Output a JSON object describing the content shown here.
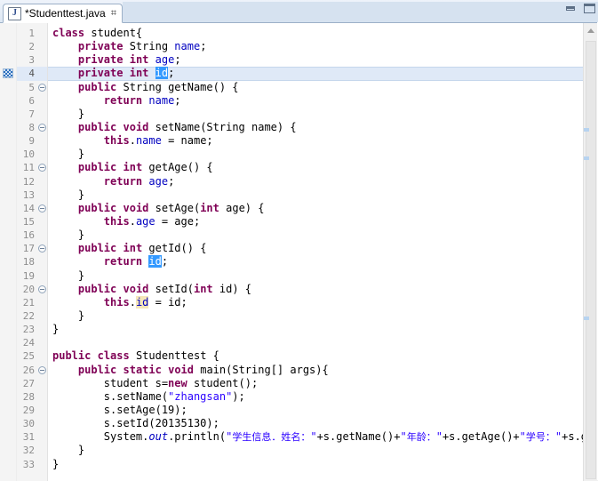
{
  "window": {
    "minimize_label": "Minimize",
    "maximize_label": "Maximize",
    "minimize_icon": "minimize-icon",
    "maximize_icon": "maximize-icon"
  },
  "tab": {
    "icon_glyph": "J",
    "icon_name": "java-file-icon",
    "title": "*Studenttest.java",
    "close_glyph": "⌗",
    "dirty": true
  },
  "editor": {
    "current_line": 4,
    "marker_line": 4,
    "marker_name": "occurrence-marker",
    "line_count": 33,
    "selection_text": "id",
    "lines": [
      {
        "n": 1,
        "fold": false,
        "code_html": "<span class=\"kw\">class</span> student{"
      },
      {
        "n": 2,
        "fold": false,
        "code_html": "    <span class=\"kw\">private</span> String <span class=\"fld\">name</span>;"
      },
      {
        "n": 3,
        "fold": false,
        "code_html": "    <span class=\"kw\">private</span> <span class=\"kw\">int</span> <span class=\"fld\">age</span>;"
      },
      {
        "n": 4,
        "fold": false,
        "current": true,
        "code_html": "    <span class=\"kw\">private</span> <span class=\"kw\">int</span> <span class=\"sel\">id</span>;"
      },
      {
        "n": 5,
        "fold": true,
        "code_html": "    <span class=\"kw\">public</span> String getName() {"
      },
      {
        "n": 6,
        "fold": false,
        "code_html": "        <span class=\"kw\">return</span> <span class=\"fld\">name</span>;"
      },
      {
        "n": 7,
        "fold": false,
        "code_html": "    }"
      },
      {
        "n": 8,
        "fold": true,
        "code_html": "    <span class=\"kw\">public</span> <span class=\"kw\">void</span> setName(String name) {"
      },
      {
        "n": 9,
        "fold": false,
        "code_html": "        <span class=\"kw\">this</span>.<span class=\"fld\">name</span> = name;"
      },
      {
        "n": 10,
        "fold": false,
        "code_html": "    }"
      },
      {
        "n": 11,
        "fold": true,
        "code_html": "    <span class=\"kw\">public</span> <span class=\"kw\">int</span> getAge() {"
      },
      {
        "n": 12,
        "fold": false,
        "code_html": "        <span class=\"kw\">return</span> <span class=\"fld\">age</span>;"
      },
      {
        "n": 13,
        "fold": false,
        "code_html": "    }"
      },
      {
        "n": 14,
        "fold": true,
        "code_html": "    <span class=\"kw\">public</span> <span class=\"kw\">void</span> setAge(<span class=\"kw\">int</span> age) {"
      },
      {
        "n": 15,
        "fold": false,
        "code_html": "        <span class=\"kw\">this</span>.<span class=\"fld\">age</span> = age;"
      },
      {
        "n": 16,
        "fold": false,
        "code_html": "    }"
      },
      {
        "n": 17,
        "fold": true,
        "code_html": "    <span class=\"kw\">public</span> <span class=\"kw\">int</span> getId() {"
      },
      {
        "n": 18,
        "fold": false,
        "code_html": "        <span class=\"kw\">return</span> <span class=\"sel\">id</span>;"
      },
      {
        "n": 19,
        "fold": false,
        "code_html": "    }"
      },
      {
        "n": 20,
        "fold": true,
        "code_html": "    <span class=\"kw\">public</span> <span class=\"kw\">void</span> setId(<span class=\"kw\">int</span> id) {"
      },
      {
        "n": 21,
        "fold": false,
        "code_html": "        <span class=\"kw\">this</span>.<span class=\"fld occ\">id</span> = id;"
      },
      {
        "n": 22,
        "fold": false,
        "code_html": "    }"
      },
      {
        "n": 23,
        "fold": false,
        "code_html": "}"
      },
      {
        "n": 24,
        "fold": false,
        "code_html": ""
      },
      {
        "n": 25,
        "fold": false,
        "code_html": "<span class=\"kw\">public</span> <span class=\"kw\">class</span> Studenttest {"
      },
      {
        "n": 26,
        "fold": true,
        "code_html": "    <span class=\"kw\">public</span> <span class=\"kw\">static</span> <span class=\"kw\">void</span> main(String[] args){"
      },
      {
        "n": 27,
        "fold": false,
        "code_html": "        student s=<span class=\"kw\">new</span> student();"
      },
      {
        "n": 28,
        "fold": false,
        "code_html": "        s.setName(<span class=\"str\">\"zhangsan\"</span>);"
      },
      {
        "n": 29,
        "fold": false,
        "code_html": "        s.setAge(19);"
      },
      {
        "n": 30,
        "fold": false,
        "code_html": "        s.setId(20135130);"
      },
      {
        "n": 31,
        "fold": false,
        "code_html": "        System.<span class=\"stfld\">out</span>.println(<span class=\"str\">\"</span><span class=\"cn\">学生信息．姓名：</span><span class=\"str\">\"</span>+s.getName()+<span class=\"str\">\"</span><span class=\"cn\">年龄：</span><span class=\"str\">\"</span>+s.getAge()+<span class=\"str\">\"</span><span class=\"cn\">学号：</span><span class=\"str\">\"</span>+s.getId());"
      },
      {
        "n": 32,
        "fold": false,
        "code_html": "    }"
      },
      {
        "n": 33,
        "fold": false,
        "code_html": "}"
      }
    ]
  },
  "scrollbar": {
    "up_arrow_name": "scroll-up-arrow",
    "thumb_name": "vertical-scroll-thumb",
    "overview_marker_tops": [
      118,
      150,
      330
    ]
  },
  "colors": {
    "keyword": "#7f0055",
    "string": "#2a00ff",
    "field": "#0000c0",
    "selection": "#3399ff",
    "occurrence": "#f5e6b8",
    "current_line": "#dfe9f7",
    "tab_bar": "#d6e2f0"
  }
}
